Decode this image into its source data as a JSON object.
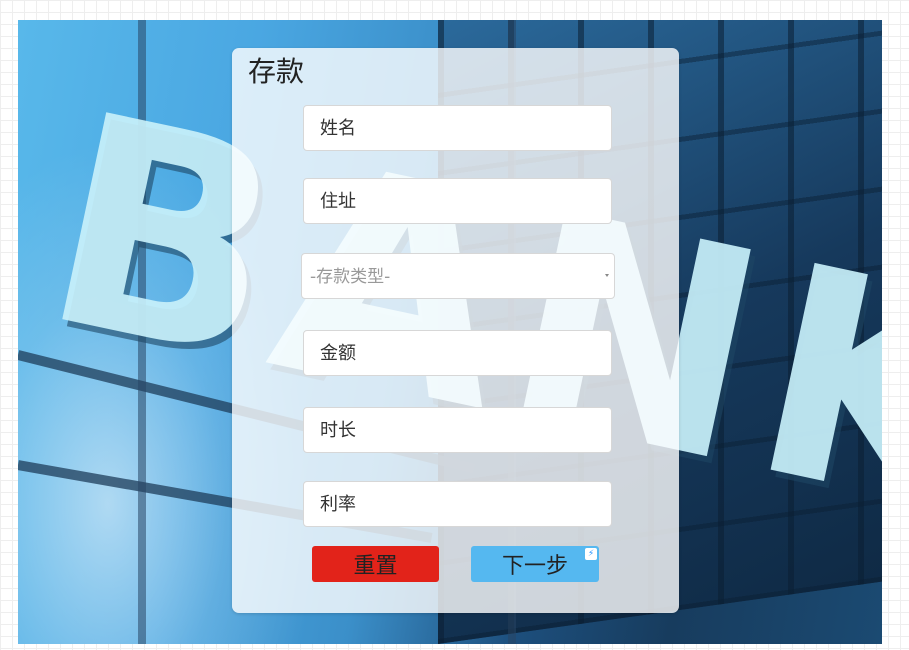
{
  "form": {
    "title": "存款",
    "fields": {
      "name_placeholder": "姓名",
      "address_placeholder": "住址",
      "deposit_type_selected": "-存款类型-",
      "amount_placeholder": "金额",
      "duration_placeholder": "时长",
      "rate_placeholder": "利率"
    },
    "buttons": {
      "reset_label": "重置",
      "next_label": "下一步"
    }
  },
  "background": {
    "sign_text": "BANK"
  },
  "colors": {
    "reset_button": "#e2231a",
    "next_button": "#55b8f0",
    "panel": "rgba(255,255,255,0.80)"
  },
  "icons": {
    "next_button_badge": "lightning-icon",
    "select_arrow": "chevron-down-icon"
  }
}
